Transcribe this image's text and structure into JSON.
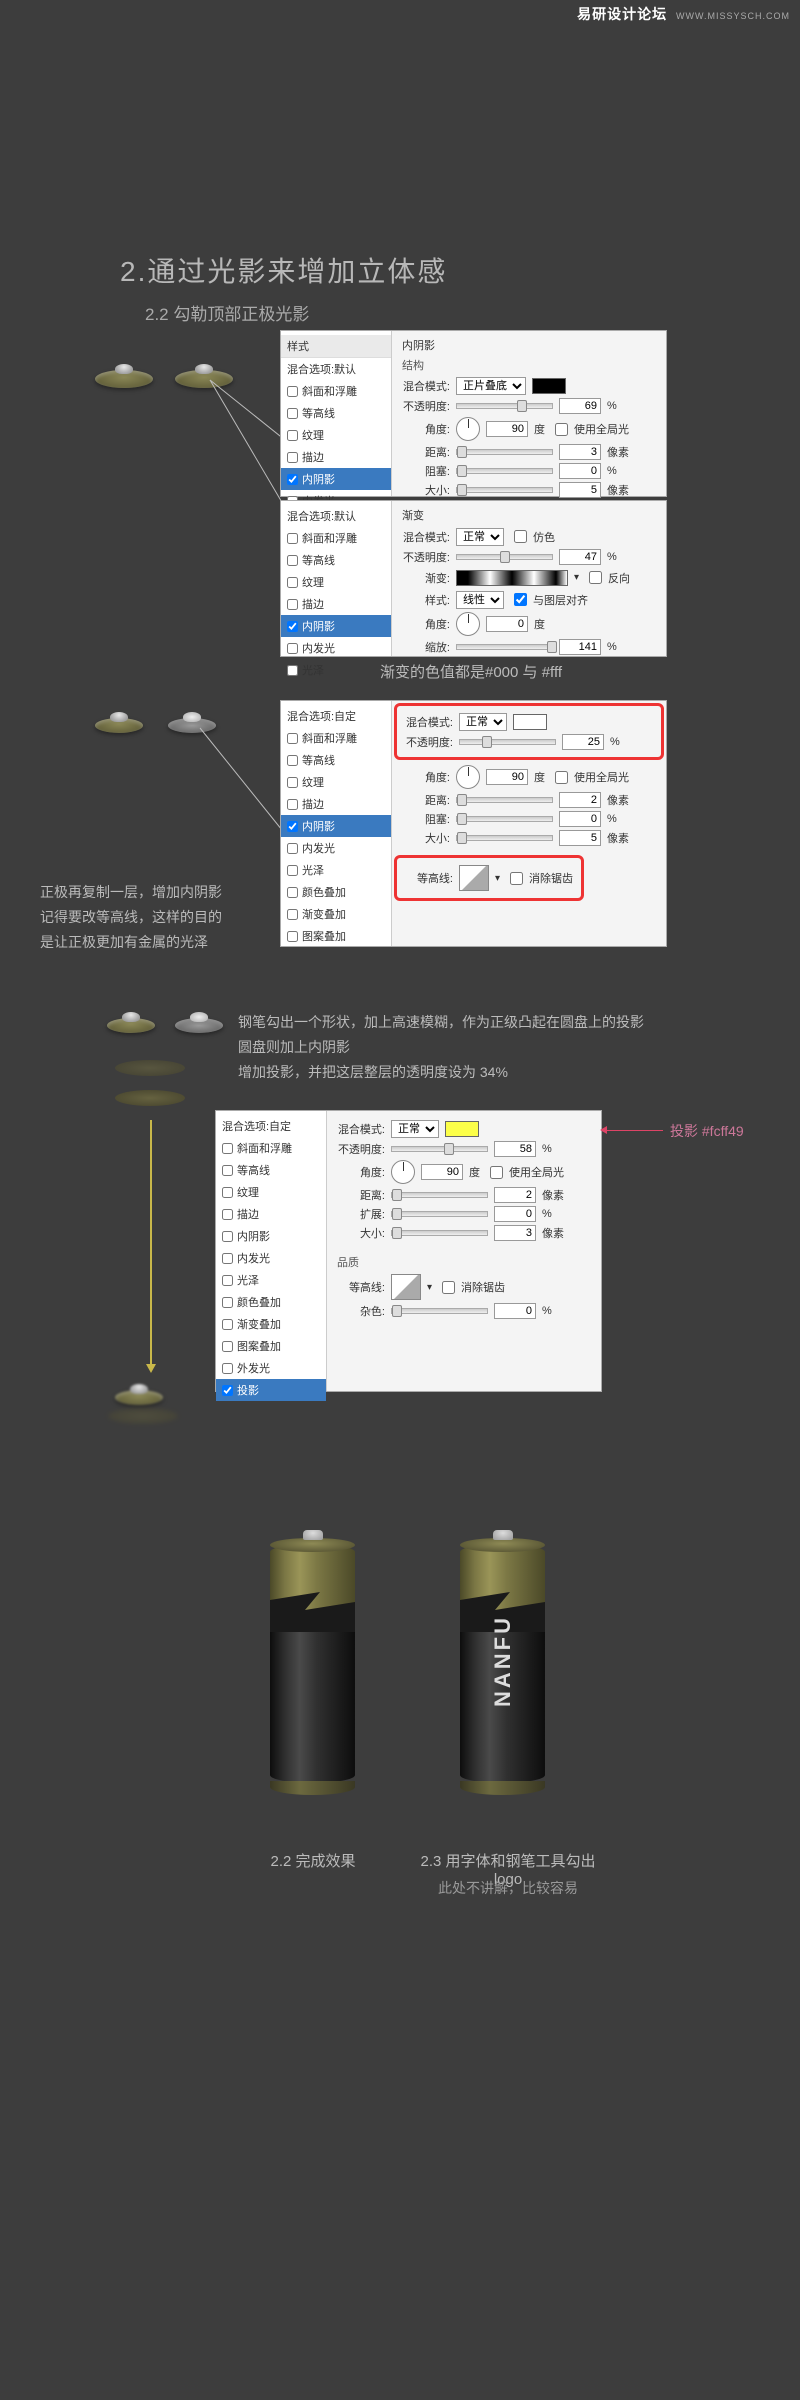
{
  "watermark": {
    "main": "易研设计论坛",
    "sub": "WWW.MISSYSCH.COM"
  },
  "section": {
    "num": "2.",
    "title": "通过光影来增加立体感",
    "sub22": "2.2 勾勒顶部正极光影"
  },
  "styleList": {
    "hdr": "样式",
    "blendDefault": "混合选项:默认",
    "blendCustom": "混合选项:自定",
    "bevel": "斜面和浮雕",
    "contour": "等高线",
    "texture": "纹理",
    "stroke": "描边",
    "innerShadow": "内阴影",
    "innerGlow": "内发光",
    "satin": "光泽",
    "colorOverlay": "颜色叠加",
    "gradOverlay": "渐变叠加",
    "patternOverlay": "图案叠加",
    "outerGlow": "外发光",
    "dropShadow": "投影"
  },
  "labels": {
    "innerShadow": "内阴影",
    "structure": "结构",
    "blendMode": "混合模式:",
    "opacity": "不透明度:",
    "angle": "角度:",
    "deg": "度",
    "useGlobal": "使用全局光",
    "distance": "距离:",
    "choke": "阻塞:",
    "spread": "扩展:",
    "size": "大小:",
    "px": "像素",
    "pct": "%",
    "gradient": "渐变",
    "grad": "渐变:",
    "reverse": "反向",
    "dither": "仿色",
    "style": "样式:",
    "alignLayer": "与图层对齐",
    "scale": "缩放:",
    "contour": "等高线:",
    "antiAlias": "消除锯齿",
    "quality": "品质",
    "noise": "杂色:"
  },
  "modes": {
    "multiply": "正片叠底",
    "normal": "正常",
    "linear": "线性"
  },
  "panel1": {
    "opacity": "69",
    "angle": "90",
    "distance": "3",
    "choke": "0",
    "size": "5"
  },
  "panel2": {
    "opacity": "47",
    "angle": "0",
    "scale": "141"
  },
  "note_gradient": "渐变的色值都是#000 与 #fff",
  "panel3": {
    "opacity": "25",
    "angle": "90",
    "distance": "2",
    "choke": "0",
    "size": "5"
  },
  "note_left3": {
    "l1": "正极再复制一层，增加内阴影",
    "l2": "记得要改等高线，这样的目的",
    "l3": "是让正极更加有金属的光泽"
  },
  "note_mid4": {
    "l1": "钢笔勾出一个形状，加上高速模糊，作为正级凸起在圆盘上的投影",
    "l2": "圆盘则加上内阴影",
    "l3": "增加投影，并把这层整层的透明度设为 34%"
  },
  "panel4": {
    "opacity": "58",
    "angle": "90",
    "distance": "2",
    "spread": "0",
    "size": "3",
    "noise": "0"
  },
  "shadow_note": "投影 #fcff49",
  "caption22": "2.2 完成效果",
  "caption23": "2.3 用字体和钢笔工具勾出logo",
  "caption23b": "此处不讲解，比较容易",
  "logo": "NANFU"
}
